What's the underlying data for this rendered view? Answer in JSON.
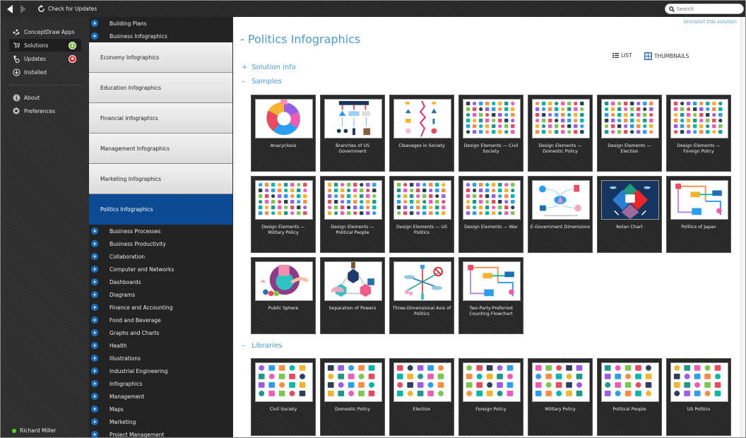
{
  "topbar": {
    "back_icon": "back-arrow-icon",
    "forward_icon": "forward-arrow-icon",
    "check_updates_label": "Check for Updates",
    "search_placeholder": "Search"
  },
  "sidebar": {
    "items": [
      {
        "label": "ConceptDraw Apps",
        "icon": "apps-icon"
      },
      {
        "label": "Solutions",
        "icon": "cart-icon",
        "badge": "1",
        "badge_color": "#7cc242",
        "active": true
      },
      {
        "label": "Updates",
        "icon": "updates-icon",
        "badge": "4",
        "badge_color": "#e8262c"
      },
      {
        "label": "Installed",
        "icon": "download-circle-icon"
      },
      {
        "label": "About",
        "icon": "info-icon"
      },
      {
        "label": "Preferences",
        "icon": "gear-icon"
      }
    ],
    "user": {
      "name": "Richard Miller",
      "status_color": "#52d326"
    }
  },
  "categories": {
    "top": [
      {
        "label": "Building Plans",
        "expanded": false
      },
      {
        "label": "Business Infographics",
        "expanded": true
      }
    ],
    "sub": [
      {
        "label": "Economy Infographics"
      },
      {
        "label": "Education Infographics"
      },
      {
        "label": "Financial Infographics"
      },
      {
        "label": "Management Infographics"
      },
      {
        "label": "Marketing Infographics"
      },
      {
        "label": "Politics Infographics",
        "active": true
      }
    ],
    "rest": [
      {
        "label": "Business Processes"
      },
      {
        "label": "Business Productivity"
      },
      {
        "label": "Collaboration"
      },
      {
        "label": "Computer and Networks"
      },
      {
        "label": "Dashboards"
      },
      {
        "label": "Diagrams"
      },
      {
        "label": "Finance and Accounting"
      },
      {
        "label": "Food and Beverage"
      },
      {
        "label": "Graphs and Charts"
      },
      {
        "label": "Health"
      },
      {
        "label": "Illustrations"
      },
      {
        "label": "Industrial Engineering"
      },
      {
        "label": "Infographics"
      },
      {
        "label": "Management"
      },
      {
        "label": "Maps"
      },
      {
        "label": "Marketing"
      },
      {
        "label": "Project Management"
      }
    ]
  },
  "main": {
    "uninstall_label": "Uninstall this solution",
    "title": "Politics Infographics",
    "title_prefix": "-",
    "view": {
      "list_label": "LIST",
      "thumbnails_label": "THUMBNAILS",
      "selected": "THUMBNAILS"
    },
    "sections": {
      "solution_info": {
        "sign": "+",
        "label": "Solution info"
      },
      "samples": {
        "sign": "–",
        "label": "Samples"
      },
      "libraries": {
        "sign": "–",
        "label": "Libraries"
      }
    },
    "samples": [
      {
        "label": "Anacyclosis",
        "style": "wheel"
      },
      {
        "label": "Branches of US Government",
        "style": "tree"
      },
      {
        "label": "Cleavages in Society",
        "style": "split"
      },
      {
        "label": "Design Elements — Civil Society",
        "style": "icons"
      },
      {
        "label": "Design Elements — Domestic Policy",
        "style": "icons"
      },
      {
        "label": "Design Elements — Election",
        "style": "icons"
      },
      {
        "label": "Design Elements — Foreign Policy",
        "style": "icons"
      },
      {
        "label": "Design Elements — Military Policy",
        "style": "icons"
      },
      {
        "label": "Design Elements — Political People",
        "style": "icons"
      },
      {
        "label": "Design Elements — US Politics",
        "style": "icons"
      },
      {
        "label": "Design Elements — War",
        "style": "icons"
      },
      {
        "label": "E-Government Dimensions",
        "style": "network"
      },
      {
        "label": "Nolan Chart",
        "style": "nolan"
      },
      {
        "label": "Politics of Japan",
        "style": "flow"
      },
      {
        "label": "Public Sphere",
        "style": "sphere"
      },
      {
        "label": "Separation of Powers",
        "style": "triangle"
      },
      {
        "label": "Three-Dimensional Axis of Politics",
        "style": "axis"
      },
      {
        "label": "Two-Party-Preferred Counting Flowchart",
        "style": "flow"
      }
    ],
    "libraries": [
      {
        "label": "Civil Society"
      },
      {
        "label": "Domestic Policy"
      },
      {
        "label": "Election"
      },
      {
        "label": "Foreign Policy"
      },
      {
        "label": "Military Policy"
      },
      {
        "label": "Political People"
      },
      {
        "label": "US Politics"
      }
    ]
  },
  "colors": {
    "accent": "#4b9ad8",
    "selected_category": "#0d4a94",
    "bullet": "#1a6fc0"
  }
}
